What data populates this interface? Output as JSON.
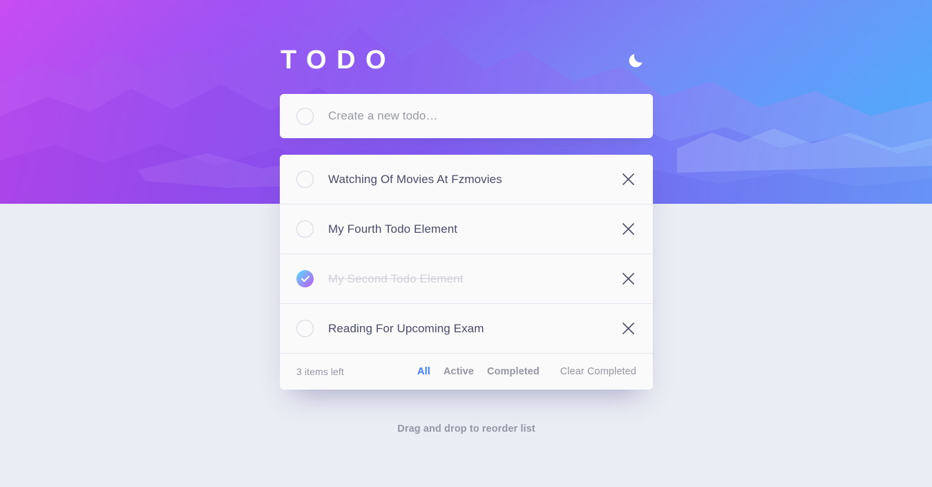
{
  "app": {
    "title": "TODO",
    "theme_toggle_icon": "moon-icon"
  },
  "new_todo": {
    "placeholder": "Create a new todo…",
    "value": ""
  },
  "todos": [
    {
      "label": "Watching Of Movies At Fzmovies",
      "completed": false
    },
    {
      "label": "My Fourth Todo Element",
      "completed": false
    },
    {
      "label": "My Second Todo Element",
      "completed": true
    },
    {
      "label": "Reading For Upcoming Exam",
      "completed": false
    }
  ],
  "footer": {
    "items_left": "3 items left",
    "filters": [
      {
        "label": "All",
        "active": true
      },
      {
        "label": "Active",
        "active": false
      },
      {
        "label": "Completed",
        "active": false
      }
    ],
    "clear_completed": "Clear Completed"
  },
  "hint": "Drag and drop to reorder list",
  "colors": {
    "accent_blue": "#3a7cfd",
    "check_gradient_start": "#57ddff",
    "check_gradient_end": "#c058f3",
    "text_dark": "#494c6b",
    "text_muted": "#9495a5",
    "page_bg": "#ebedf4",
    "card_bg": "#fafafa"
  }
}
